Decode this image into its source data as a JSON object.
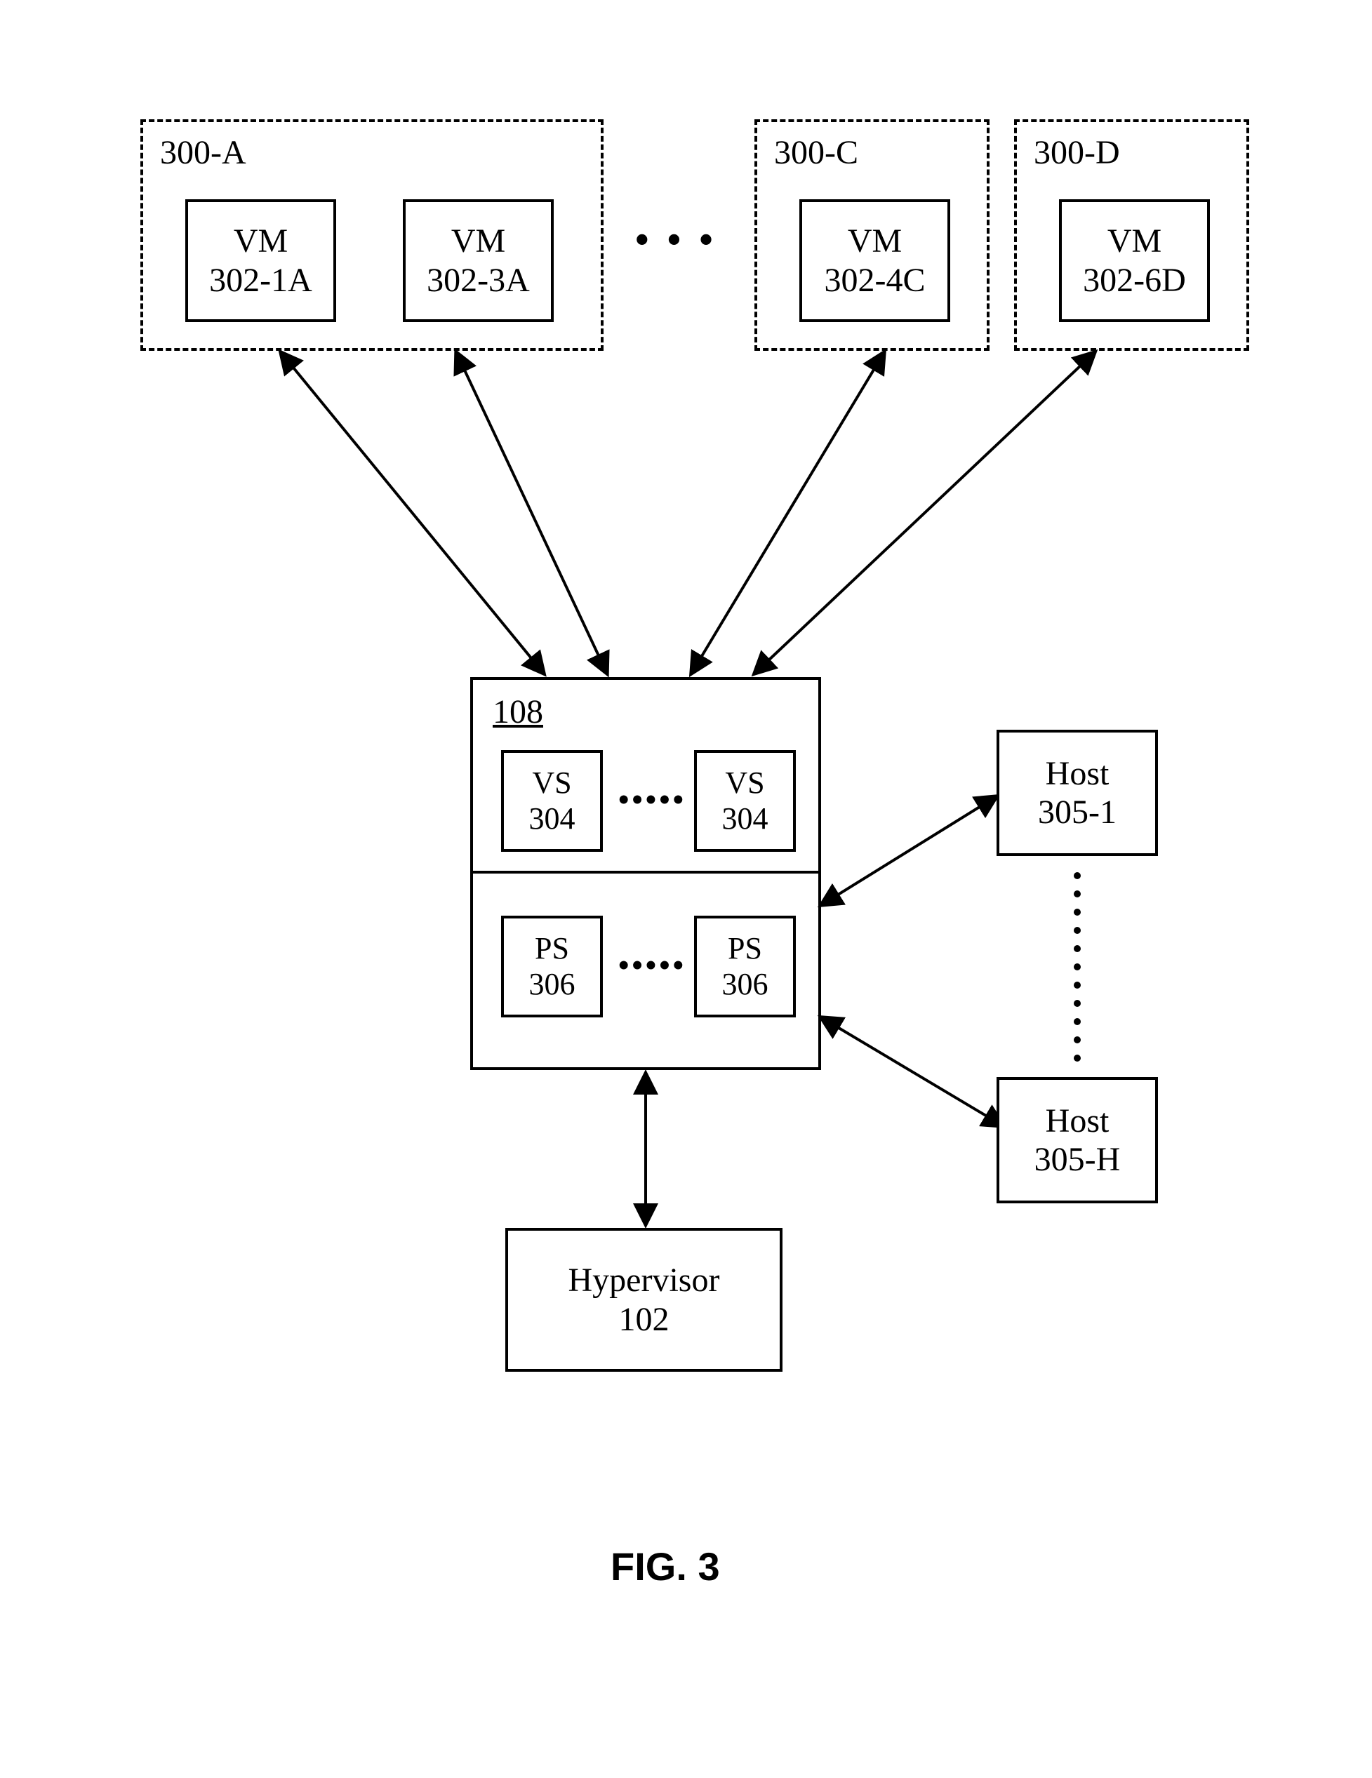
{
  "figure_caption": "FIG. 3",
  "tenant_groups": {
    "a": {
      "label": "300-A",
      "vm1": {
        "t": "VM",
        "id": "302-1A"
      },
      "vm2": {
        "t": "VM",
        "id": "302-3A"
      }
    },
    "c": {
      "label": "300-C",
      "vm": {
        "t": "VM",
        "id": "302-4C"
      }
    },
    "d": {
      "label": "300-D",
      "vm": {
        "t": "VM",
        "id": "302-6D"
      }
    }
  },
  "hub": {
    "id": "108",
    "vs": {
      "label": "VS",
      "id": "304"
    },
    "ps": {
      "label": "PS",
      "id": "306"
    }
  },
  "hosts": {
    "top": {
      "label": "Host",
      "id": "305-1"
    },
    "bot": {
      "label": "Host",
      "id": "305-H"
    }
  },
  "hypervisor": {
    "label": "Hypervisor",
    "id": "102"
  },
  "ellipses": {
    "three": "• • •",
    "five": "•••••"
  }
}
